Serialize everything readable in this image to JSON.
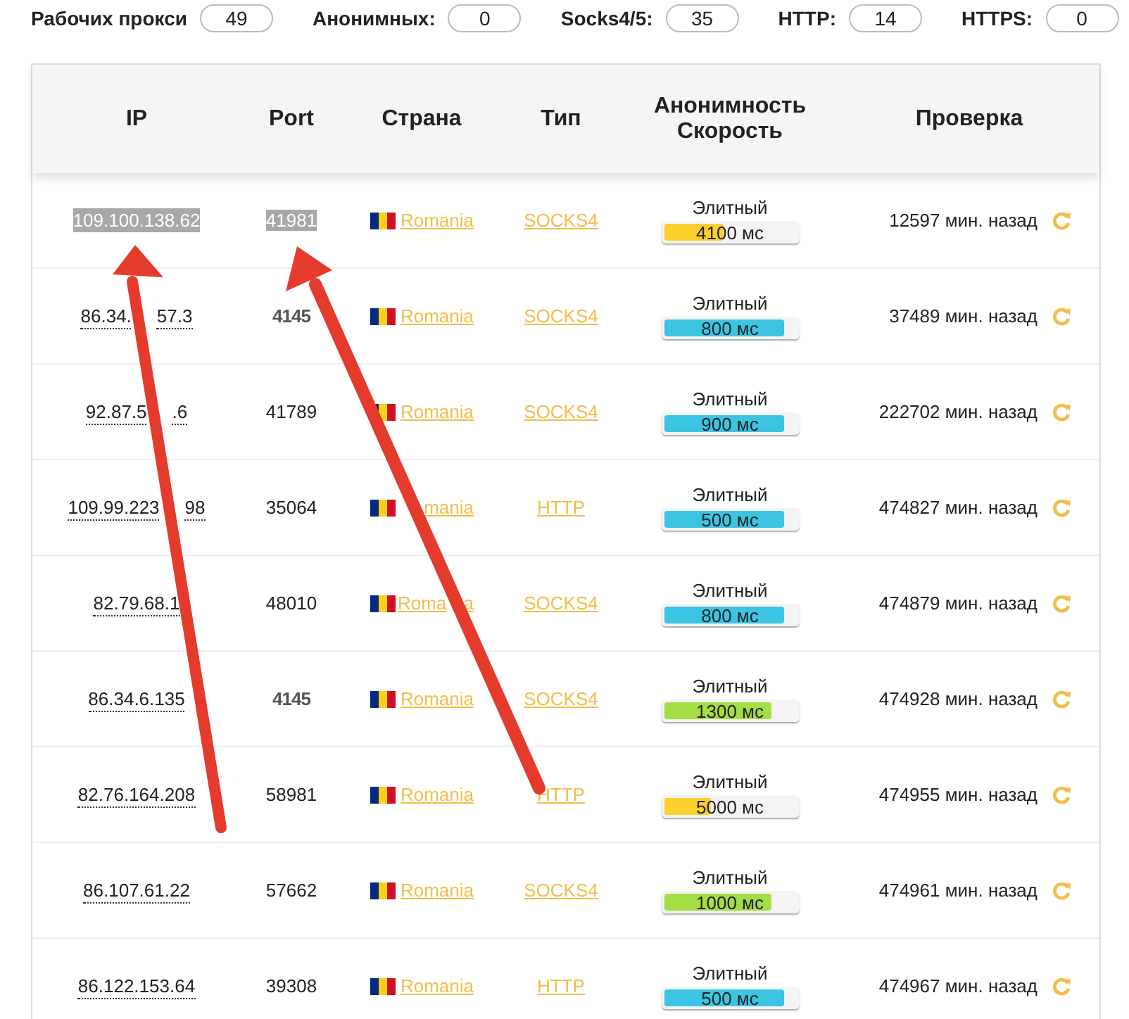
{
  "stats": [
    {
      "label": "Рабочих прокси",
      "value": "49"
    },
    {
      "label": "Анонимных:",
      "value": "0"
    },
    {
      "label": "Socks4/5:",
      "value": "35"
    },
    {
      "label": "HTTP:",
      "value": "14"
    },
    {
      "label": "HTTPS:",
      "value": "0"
    }
  ],
  "table": {
    "columns": [
      "IP",
      "Port",
      "Страна",
      "Тип",
      "Анонимность Скорость",
      "Проверка"
    ],
    "rows": [
      {
        "ip": [
          "109.100.138.62"
        ],
        "port": "41981",
        "highlighted": true,
        "bold_port": false,
        "country": [
          "Romania"
        ],
        "type": "SOCKS4",
        "anonymity": "Элитный",
        "speed": "4100 мс",
        "level": 0.43,
        "color": "#fbd02c",
        "checked": "12597 мин. назад"
      },
      {
        "ip": [
          "86.34.",
          "57.3"
        ],
        "port": "4145",
        "highlighted": false,
        "bold_port": true,
        "country": [
          "Romania"
        ],
        "type": "SOCKS4",
        "anonymity": "Элитный",
        "speed": "800 мс",
        "level": 0.87,
        "color": "#3cc5e3",
        "checked": "37489 мин. назад"
      },
      {
        "ip": [
          "92.87.5",
          ".6"
        ],
        "port": "41789",
        "highlighted": false,
        "bold_port": false,
        "country": [
          "Romania"
        ],
        "type": "SOCKS4",
        "anonymity": "Элитный",
        "speed": "900 мс",
        "level": 0.87,
        "color": "#3cc5e3",
        "checked": "222702 мин. назад"
      },
      {
        "ip": [
          "109.99.223",
          "98"
        ],
        "port": "35064",
        "highlighted": false,
        "bold_port": false,
        "country": [
          "mania"
        ],
        "type": "HTTP",
        "anonymity": "Элитный",
        "speed": "500 мс",
        "level": 0.87,
        "color": "#3cc5e3",
        "checked": "474827 мин. назад"
      },
      {
        "ip": [
          "82.79.68.1"
        ],
        "port": "48010",
        "highlighted": false,
        "bold_port": false,
        "country": [
          "Roma",
          "a"
        ],
        "type": "SOCKS4",
        "anonymity": "Элитный",
        "speed": "800 мс",
        "level": 0.87,
        "color": "#3cc5e3",
        "checked": "474879 мин. назад"
      },
      {
        "ip": [
          "86.34.6.135"
        ],
        "port": "4145",
        "highlighted": false,
        "bold_port": true,
        "country": [
          "Romania"
        ],
        "type": "SOCKS4",
        "anonymity": "Элитный",
        "speed": "1300 мс",
        "level": 0.78,
        "color": "#a5de44",
        "checked": "474928 мин. назад"
      },
      {
        "ip": [
          "82.76.164.208"
        ],
        "port": "58981",
        "highlighted": false,
        "bold_port": false,
        "country": [
          "Romania"
        ],
        "type": "HTTP",
        "anonymity": "Элитный",
        "speed": "5000 мс",
        "level": 0.34,
        "color": "#fbd02c",
        "checked": "474955 мин. назад"
      },
      {
        "ip": [
          "86.107.61.22"
        ],
        "port": "57662",
        "highlighted": false,
        "bold_port": false,
        "country": [
          "Romania"
        ],
        "type": "SOCKS4",
        "anonymity": "Элитный",
        "speed": "1000 мс",
        "level": 0.78,
        "color": "#a5de44",
        "checked": "474961 мин. назад"
      },
      {
        "ip": [
          "86.122.153.64"
        ],
        "port": "39308",
        "highlighted": false,
        "bold_port": false,
        "country": [
          "Romania"
        ],
        "type": "HTTP",
        "anonymity": "Элитный",
        "speed": "500 мс",
        "level": 0.87,
        "color": "#3cc5e3",
        "checked": "474967 мин. назад"
      }
    ]
  }
}
